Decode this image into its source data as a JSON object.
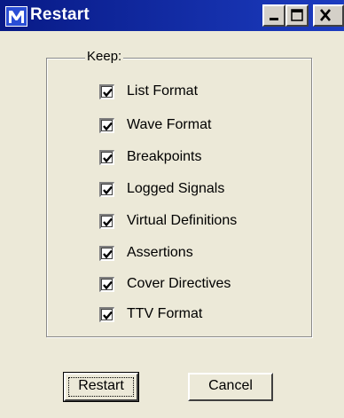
{
  "window": {
    "title": "Restart",
    "app_icon": "modelsim-m-icon",
    "controls": {
      "minimize": "minimize-icon",
      "maximize": "maximize-icon",
      "close": "close-icon"
    }
  },
  "group": {
    "label": "Keep:",
    "items": [
      {
        "label": "List Format",
        "checked": true
      },
      {
        "label": "Wave Format",
        "checked": true
      },
      {
        "label": "Breakpoints",
        "checked": true
      },
      {
        "label": "Logged Signals",
        "checked": true
      },
      {
        "label": "Virtual Definitions",
        "checked": true
      },
      {
        "label": "Assertions",
        "checked": true
      },
      {
        "label": "Cover Directives",
        "checked": true
      },
      {
        "label": "TTV Format",
        "checked": true
      }
    ]
  },
  "buttons": {
    "restart": "Restart",
    "cancel": "Cancel"
  },
  "colors": {
    "titlebar": "#0d1f8f",
    "face": "#ece9d8"
  }
}
